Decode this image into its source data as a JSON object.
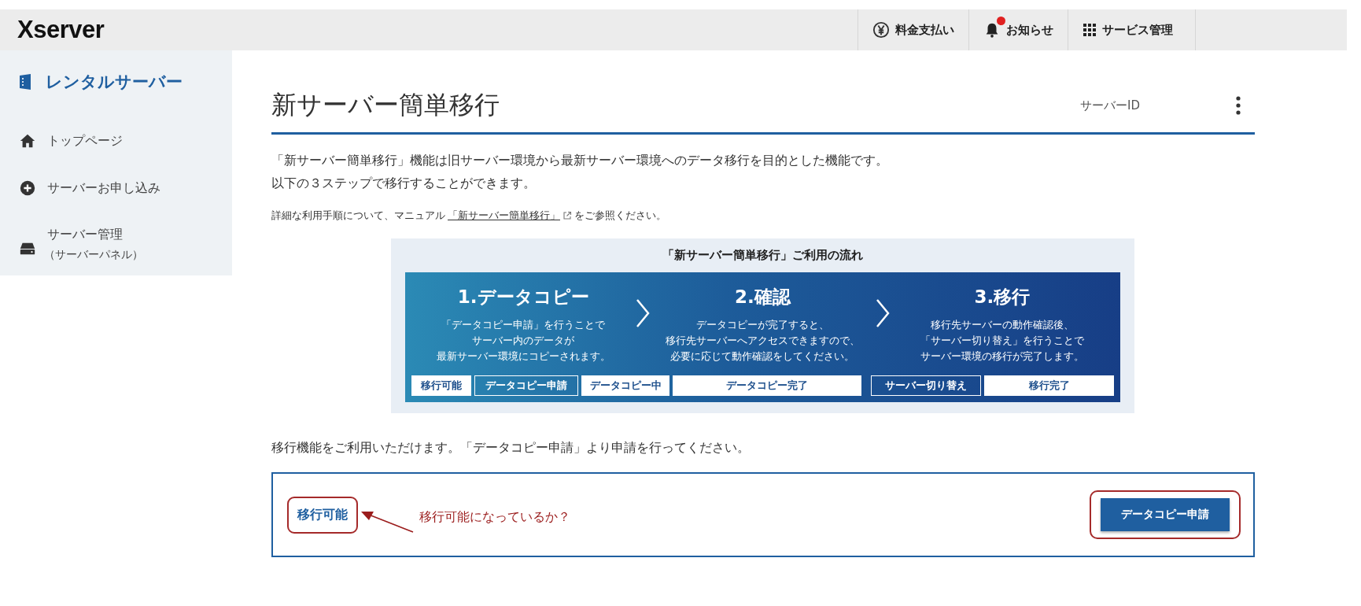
{
  "header": {
    "logo": "Xserver",
    "nav": [
      {
        "label": "料金支払い",
        "badge": false
      },
      {
        "label": "お知らせ",
        "badge": true
      },
      {
        "label": "サービス管理",
        "badge": false
      }
    ]
  },
  "sidebar": {
    "title": "レンタルサーバー",
    "items": [
      {
        "label": "トップページ"
      },
      {
        "label": "サーバーお申し込み"
      },
      {
        "label": "サーバー管理",
        "sub": "（サーバーパネル）"
      }
    ]
  },
  "page": {
    "title": "新サーバー簡単移行",
    "server_id_label": "サーバーID",
    "intro": [
      "「新サーバー簡単移行」機能は旧サーバー環境から最新サーバー環境へのデータ移行を目的とした機能です。",
      "以下の３ステップで移行することができます。"
    ],
    "manual_note": {
      "before": "詳細な利用手順について、マニュアル",
      "link": "「新サーバー簡単移行」",
      "after": "をご参照ください。"
    },
    "flow": {
      "title": "「新サーバー簡単移行」ご利用の流れ",
      "steps": [
        {
          "heading": "1.データコピー",
          "description": [
            "「データコピー申請」を行うことで",
            "サーバー内のデータが",
            "最新サーバー環境にコピーされます。"
          ]
        },
        {
          "heading": "2.確認",
          "description": [
            "データコピーが完了すると、",
            "移行先サーバーへアクセスできますので、",
            "必要に応じて動作確認をしてください。"
          ]
        },
        {
          "heading": "3.移行",
          "description": [
            "移行先サーバーの動作確認後、",
            "「サーバー切り替え」を行うことで",
            "サーバー環境の移行が完了します。"
          ]
        }
      ],
      "statuses": [
        {
          "label": "移行可能",
          "highlighted": true
        },
        {
          "label": "データコピー申請",
          "highlighted": false
        },
        {
          "label": "データコピー中",
          "highlighted": true
        },
        {
          "label": "データコピー完了",
          "highlighted": true
        },
        {
          "label": "サーバー切り替え",
          "highlighted": false
        },
        {
          "label": "移行完了",
          "highlighted": true
        }
      ]
    },
    "availability_message": "移行機能をご利用いただけます。「データコピー申請」より申請を行ってください。",
    "status_panel": {
      "status": "移行可能",
      "annotation": "移行可能になっているか？",
      "button": "データコピー申請"
    }
  }
}
